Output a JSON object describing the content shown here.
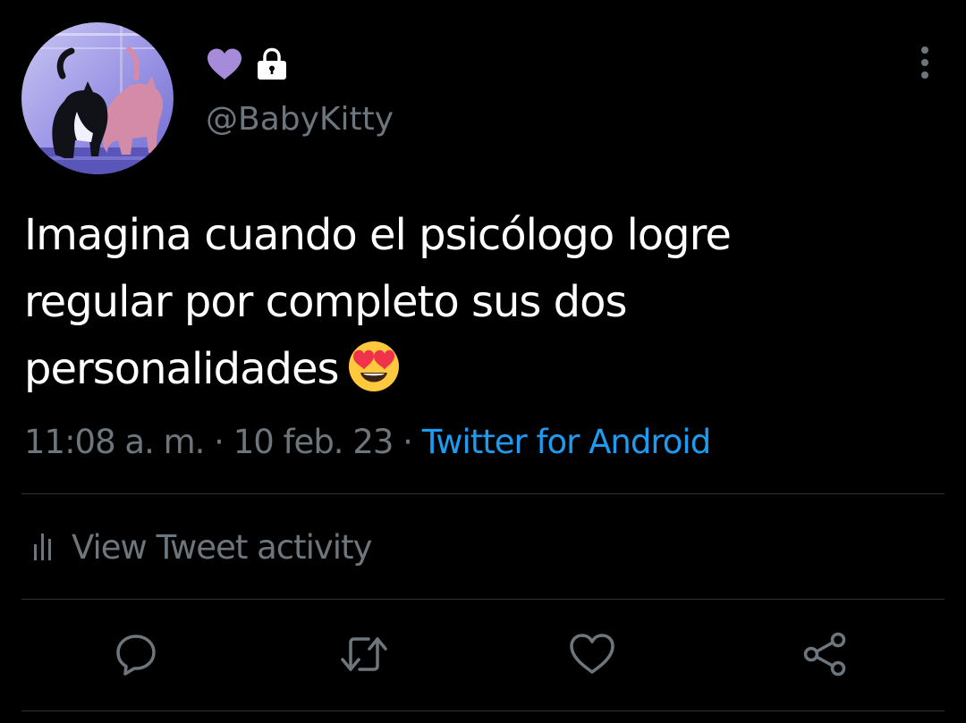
{
  "profile": {
    "handle": "@BabyKitty",
    "avatar_icon": "cats-avatar-photo",
    "name_icons": [
      "purple-heart-icon",
      "lock-icon"
    ]
  },
  "tweet": {
    "text_lines": [
      "Imagina cuando el psicólogo logre",
      "regular por completo sus dos",
      "personalidades"
    ],
    "emoji_icon": "smiling-face-with-heart-eyes-icon"
  },
  "meta": {
    "time": "11:08 a. m.",
    "separator": " · ",
    "date": "10 feb. 23",
    "source": "Twitter for Android"
  },
  "activity": {
    "label": "View Tweet activity",
    "icon": "bar-chart-icon"
  },
  "actions": [
    {
      "name": "reply",
      "icon": "reply-icon"
    },
    {
      "name": "retweet",
      "icon": "retweet-icon"
    },
    {
      "name": "like",
      "icon": "heart-icon"
    },
    {
      "name": "share",
      "icon": "share-icon"
    }
  ],
  "colors": {
    "background": "#000000",
    "text": "#ffffff",
    "secondary_text": "#6e767d",
    "link": "#1d9bf0",
    "divider": "#2f3336",
    "heart": "#a78bdb"
  }
}
